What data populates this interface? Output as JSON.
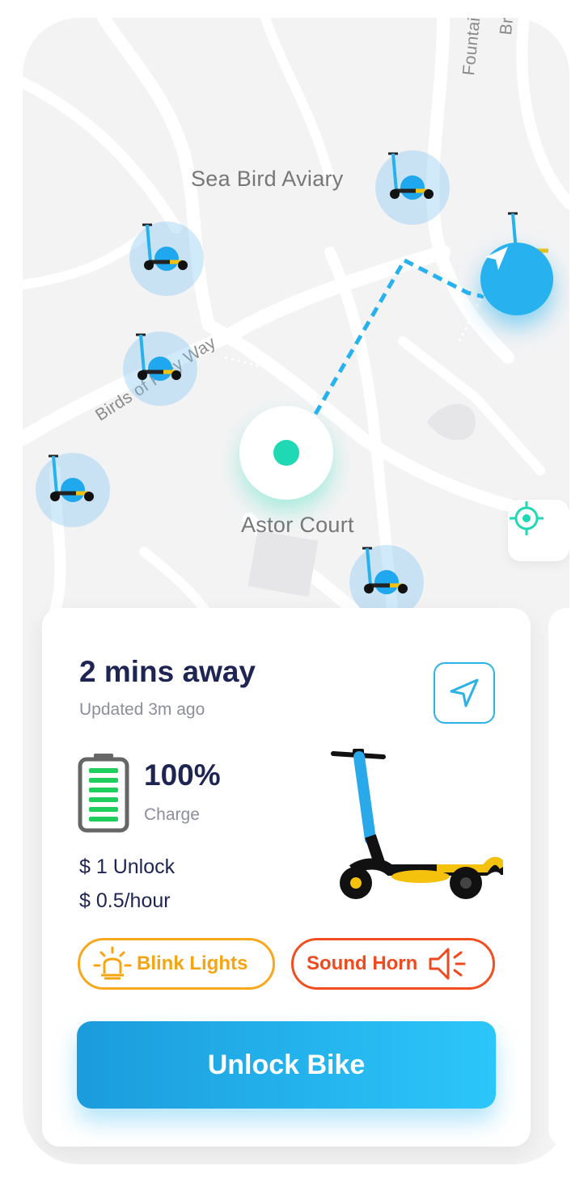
{
  "map": {
    "places": [
      "Sea Bird Aviary",
      "Astor Court"
    ],
    "roads": [
      "Birds of Prey Way",
      "Fountain",
      "Br"
    ]
  },
  "scooter_card": {
    "eta": "2 mins away",
    "updated": "Updated 3m ago",
    "charge_value": "100%",
    "charge_label": "Charge",
    "unlock_price": "$ 1 Unlock",
    "hourly_price": "$ 0.5/hour",
    "blink_lights_label": "Blink Lights",
    "sound_horn_label": "Sound Horn",
    "unlock_button_label": "Unlock Bike"
  },
  "colors": {
    "primary_blue": "#27b2ef",
    "user_dot": "#1fd9b4",
    "blink_orange": "#f6a511",
    "horn_red": "#ef4a1f",
    "text_dark": "#1f2553",
    "battery_green": "#1fcf5e"
  }
}
